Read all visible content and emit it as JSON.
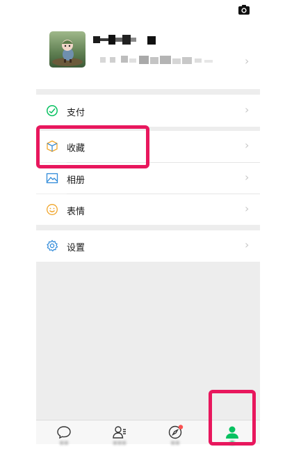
{
  "profile": {
    "name": "",
    "wechat_id": ""
  },
  "menu": {
    "pay_label": "支付",
    "favorites_label": "收藏",
    "album_label": "相册",
    "stickers_label": "表情",
    "settings_label": "设置"
  },
  "chevron": "›",
  "tabbar": {
    "active_tab": "me"
  },
  "colors": {
    "accent": "#07c160",
    "highlight": "#e8175d",
    "notification_dot": "#fa5151",
    "page_bg": "#ededed"
  }
}
